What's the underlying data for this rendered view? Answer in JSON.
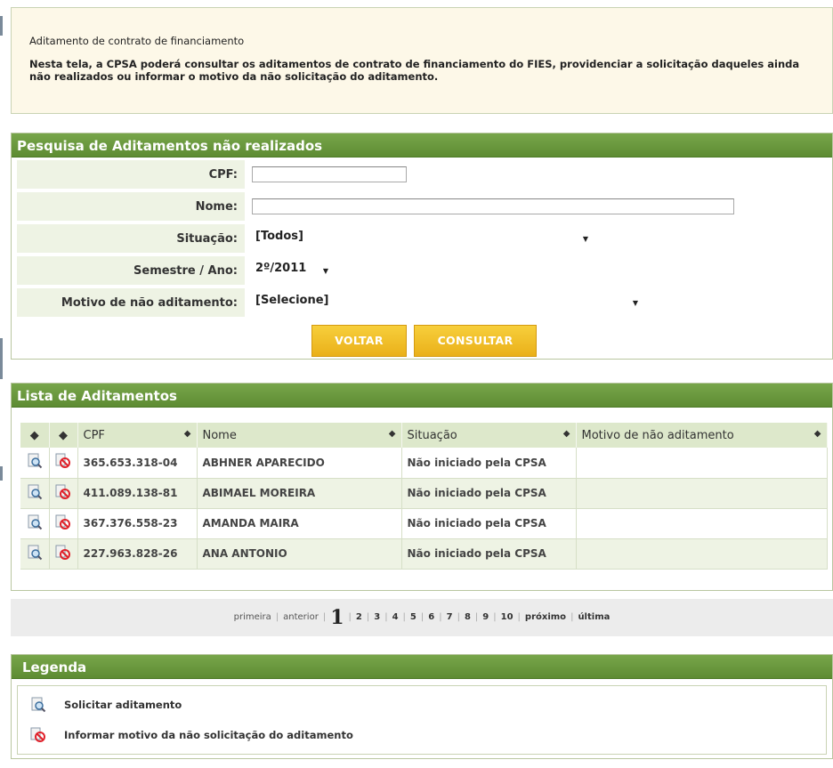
{
  "intro": {
    "title": "Aditamento de contrato de financiamento",
    "description": "Nesta tela, a CPSA poderá consultar os aditamentos de contrato de financiamento do FIES, providenciar a solicitação daqueles ainda não realizados ou informar o motivo da não solicitação do aditamento."
  },
  "search": {
    "title": "Pesquisa de Aditamentos não realizados",
    "cpf_label": "CPF:",
    "cpf_value": "",
    "nome_label": "Nome:",
    "nome_value": "",
    "situacao_label": "Situação:",
    "situacao_value": "[Todos]",
    "semestre_label": "Semestre / Ano:",
    "semestre_value": "2º/2011",
    "motivo_label": "Motivo de não aditamento:",
    "motivo_value": "[Selecione]",
    "voltar": "VOLTAR",
    "consultar": "CONSULTAR"
  },
  "list": {
    "title": "Lista de Aditamentos",
    "columns": [
      "CPF",
      "Nome",
      "Situação",
      "Motivo de não aditamento"
    ],
    "rows": [
      {
        "cpf": "365.653.318-04",
        "nome": "ABHNER APARECIDO",
        "situacao": "Não iniciado pela CPSA",
        "motivo": ""
      },
      {
        "cpf": "411.089.138-81",
        "nome": "ABIMAEL MOREIRA",
        "situacao": "Não iniciado pela CPSA",
        "motivo": ""
      },
      {
        "cpf": "367.376.558-23",
        "nome": "AMANDA MAIRA",
        "situacao": "Não iniciado pela CPSA",
        "motivo": ""
      },
      {
        "cpf": "227.963.828-26",
        "nome": "ANA ANTONIO",
        "situacao": "Não iniciado pela CPSA",
        "motivo": ""
      }
    ]
  },
  "pager": {
    "first": "primeira",
    "prev": "anterior",
    "current": "1",
    "pages": [
      "2",
      "3",
      "4",
      "5",
      "6",
      "7",
      "8",
      "9",
      "10"
    ],
    "next": "próximo",
    "last": "última"
  },
  "legend": {
    "title": "Legenda",
    "items": [
      {
        "icon": "magnifier-document-icon",
        "label": "Solicitar aditamento"
      },
      {
        "icon": "prohibited-document-icon",
        "label": "Informar motivo da não solicitação do aditamento"
      }
    ]
  },
  "colors": {
    "header_green": "#5e8c33",
    "row_alt": "#eef3e4",
    "button_yellow": "#eab019",
    "intro_bg": "#fdf8e8"
  }
}
